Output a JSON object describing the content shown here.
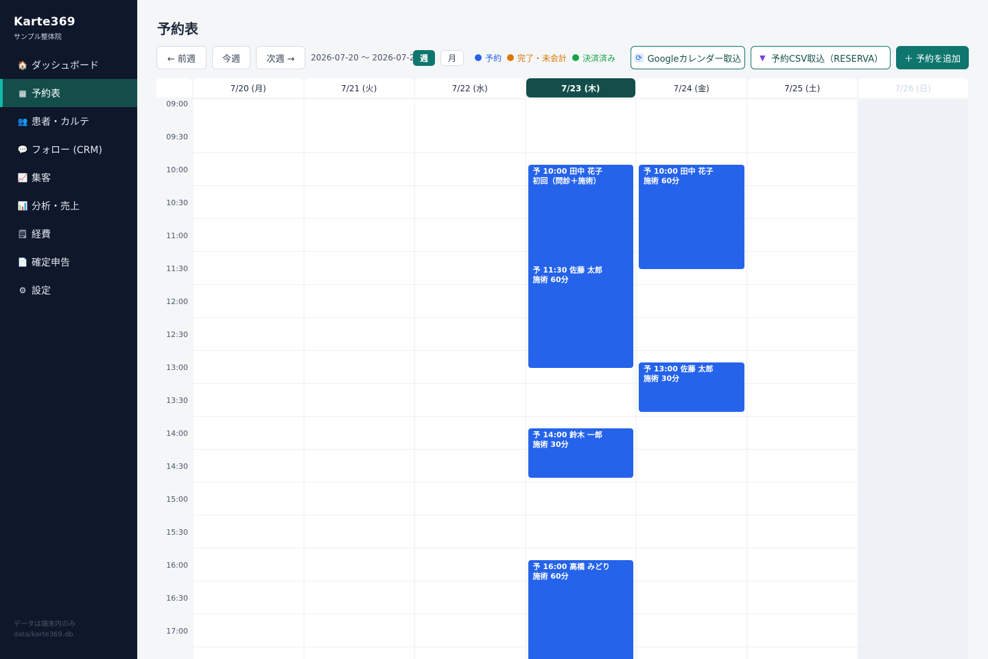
{
  "app": {
    "name": "Karte369",
    "subtitle": "サンプル整体院"
  },
  "sidebar": {
    "items": [
      {
        "label": "ダッシュボード",
        "icon": "house-icon"
      },
      {
        "label": "予約表",
        "icon": "calendar-icon",
        "active": true
      },
      {
        "label": "患者・カルテ",
        "icon": "people-icon"
      },
      {
        "label": "フォロー (CRM)",
        "icon": "speech-bubble-icon"
      },
      {
        "label": "集客",
        "icon": "chart-up-icon"
      },
      {
        "label": "分析・売上",
        "icon": "bar-chart-icon"
      },
      {
        "label": "経費",
        "icon": "receipt-icon"
      },
      {
        "label": "確定申告",
        "icon": "document-icon"
      },
      {
        "label": "設定",
        "icon": "gear-icon"
      }
    ],
    "footer_line1": "データは端末内のみ",
    "footer_line2": "data/karte369.db"
  },
  "page": {
    "title": "予約表"
  },
  "toolbar": {
    "prev_label": "← 前週",
    "today_label": "今週",
    "next_label": "次週 →",
    "range": "2026-07-20 〜 2026-07-26",
    "view_week": "週",
    "view_month": "月",
    "legend": [
      {
        "label": "予約",
        "color": "#2563eb"
      },
      {
        "label": "完了・未会計",
        "color": "#d97706"
      },
      {
        "label": "決済済み",
        "color": "#16a34a"
      }
    ],
    "google_label": "Googleカレンダー取込",
    "csv_label": "予約CSV取込（RESERVA）",
    "add_label": "＋ 予約を追加"
  },
  "calendar": {
    "days": [
      "7/20 (月)",
      "7/21 (火)",
      "7/22 (水)",
      "7/23 (木)",
      "7/24 (金)",
      "7/25 (土)",
      "7/26 (日)"
    ],
    "today_index": 3,
    "closed_index": 6,
    "times": [
      "09:00",
      "09:30",
      "10:00",
      "10:30",
      "11:00",
      "11:30",
      "12:00",
      "12:30",
      "13:00",
      "13:30",
      "14:00",
      "14:30",
      "15:00",
      "15:30",
      "16:00",
      "16:30",
      "17:00"
    ],
    "appointments": [
      {
        "day": 3,
        "start": "10:00",
        "minutes": 120,
        "line1": "予 10:00 田中 花子",
        "line2": "初回（問診＋施術）"
      },
      {
        "day": 4,
        "start": "10:00",
        "minutes": 95,
        "line1": "予 10:00 田中 花子",
        "line2": "施術 60分"
      },
      {
        "day": 3,
        "start": "11:30",
        "minutes": 95,
        "line1": "予 11:30 佐藤 太郎",
        "line2": "施術 60分"
      },
      {
        "day": 4,
        "start": "13:00",
        "minutes": 45,
        "line1": "予 13:00 佐藤 太郎",
        "line2": "施術 30分"
      },
      {
        "day": 3,
        "start": "14:00",
        "minutes": 45,
        "line1": "予 14:00 鈴木 一郎",
        "line2": "施術 30分"
      },
      {
        "day": 3,
        "start": "16:00",
        "minutes": 95,
        "line1": "予 16:00 高橋 みどり",
        "line2": "施術 60分"
      }
    ]
  }
}
